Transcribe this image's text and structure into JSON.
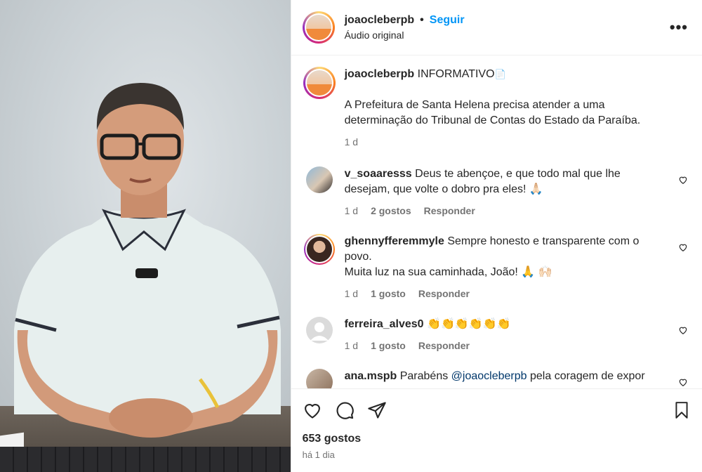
{
  "post": {
    "author": "joaocleberpb",
    "separator": "•",
    "follow_label": "Seguir",
    "audio": "Áudio original",
    "more_label": "•••"
  },
  "caption": {
    "username": "joaocleberpb",
    "title": "INFORMATIVO",
    "emoji": "📄",
    "text": "A Prefeitura de Santa Helena precisa atender a uma determinação do Tribunal de Contas do Estado da Paraíba.",
    "time": "1 d"
  },
  "comments": [
    {
      "username": "v_soaaresss",
      "text": "Deus te abençoe, e que todo mal que lhe desejam, que volte o dobro pra eles! 🙏🏻",
      "time": "1 d",
      "likes": "2 gostos",
      "reply": "Responder"
    },
    {
      "username": "ghennyfferemmyle",
      "text": "Sempre honesto e transparente com o povo.",
      "text2": "Muita luz na sua caminhada, João! 🙏 🙌🏻",
      "time": "1 d",
      "likes": "1 gosto",
      "reply": "Responder"
    },
    {
      "username": "ferreira_alves0",
      "text": "👏👏👏👏👏👏",
      "time": "1 d",
      "likes": "1 gosto",
      "reply": "Responder"
    },
    {
      "username": "ana.mspb",
      "text_before": "Parabéns ",
      "mention": "@joaocleberpb",
      "text_after": " pela coragem de expor nas"
    }
  ],
  "footer": {
    "likes": "653 gostos",
    "time": "há 1 dia"
  },
  "icons": [
    "heart-icon",
    "comment-icon",
    "share-icon",
    "bookmark-icon",
    "more-icon"
  ]
}
